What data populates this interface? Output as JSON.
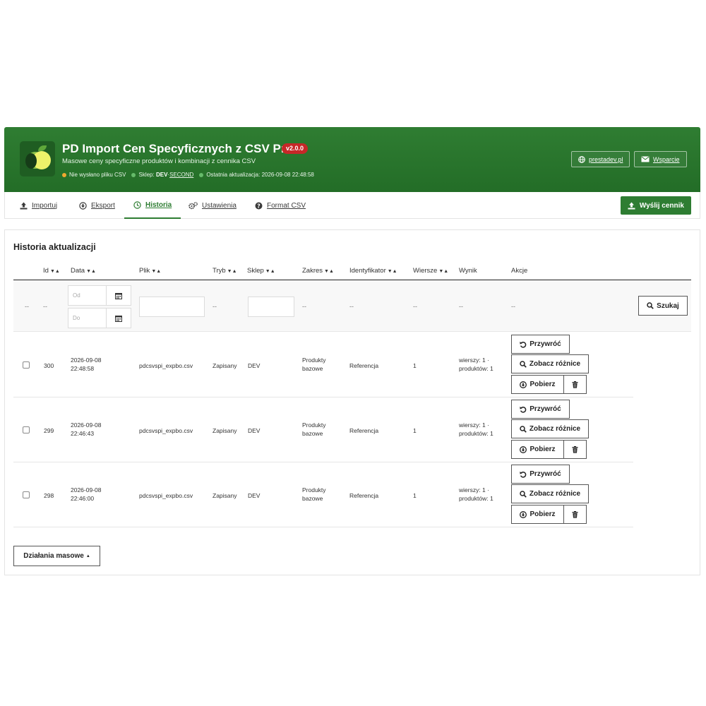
{
  "header": {
    "title": "PD Import Cen Specyficznych z CSV Pro",
    "version": "v2.0.0",
    "subtitle": "Masowe ceny specyficzne produktów i kombinacji z cennika CSV",
    "status": {
      "csv": "Nie wysłano pliku CSV",
      "shop_label": "Sklep:",
      "shop_value": "DEV",
      "shop_sep": " · ",
      "shop_second": "SECOND",
      "last_update": "Ostatnia aktualizacja: 2026-09-08 22:48:58"
    },
    "links": {
      "site": "prestadev.pl",
      "support": "Wsparcie"
    },
    "colors": {
      "header_bg": "#2f7d32",
      "badge": "#c62828",
      "dot_warning": "#f0a830",
      "dot_ok": "#66bb6a"
    }
  },
  "tabs": [
    {
      "label": "Importuj",
      "icon": "upload-icon"
    },
    {
      "label": "Eksport",
      "icon": "download-circle-icon"
    },
    {
      "label": "Historia",
      "icon": "clock-icon",
      "active": true
    },
    {
      "label": "Ustawienia",
      "icon": "gears-icon"
    },
    {
      "label": "Format CSV",
      "icon": "question-circle-icon"
    }
  ],
  "send_button": "Wyślij cennik",
  "panel": {
    "title": "Historia aktualizacji",
    "columns": {
      "id": "Id",
      "date": "Data",
      "file": "Plik",
      "mode": "Tryb",
      "shop": "Sklep",
      "scope": "Zakres",
      "identifier": "Identyfikator",
      "rows": "Wiersze",
      "result": "Wynik",
      "actions": "Akcje"
    },
    "sort_glyph": "▼▲",
    "filters": {
      "dash": "--",
      "date_from": "Od",
      "date_to": "Do",
      "file_value": "",
      "shop_value": ""
    },
    "search_button": "Szukaj",
    "rows": [
      {
        "id": "300",
        "date": "2026-09-08",
        "time": "22:48:58",
        "file": "pdcsvspi_expbo.csv",
        "mode": "Zapisany",
        "shop": "DEV",
        "scope_line1": "Produkty",
        "scope_line2": "bazowe",
        "identifier": "Referencja",
        "rows": "1",
        "result_line1": "wierszy: 1 ·",
        "result_line2": "produktów: 1"
      },
      {
        "id": "299",
        "date": "2026-09-08",
        "time": "22:46:43",
        "file": "pdcsvspi_expbo.csv",
        "mode": "Zapisany",
        "shop": "DEV",
        "scope_line1": "Produkty",
        "scope_line2": "bazowe",
        "identifier": "Referencja",
        "rows": "1",
        "result_line1": "wierszy: 1 ·",
        "result_line2": "produktów: 1"
      },
      {
        "id": "298",
        "date": "2026-09-08",
        "time": "22:46:00",
        "file": "pdcsvspi_expbo.csv",
        "mode": "Zapisany",
        "shop": "DEV",
        "scope_line1": "Produkty",
        "scope_line2": "bazowe",
        "identifier": "Referencja",
        "rows": "1",
        "result_line1": "wierszy: 1 ·",
        "result_line2": "produktów: 1"
      }
    ],
    "row_actions": {
      "restore": "Przywróć",
      "diff": "Zobacz różnice",
      "download": "Pobierz"
    },
    "bulk_button": "Działania masowe",
    "bulk_caret": "▲"
  }
}
